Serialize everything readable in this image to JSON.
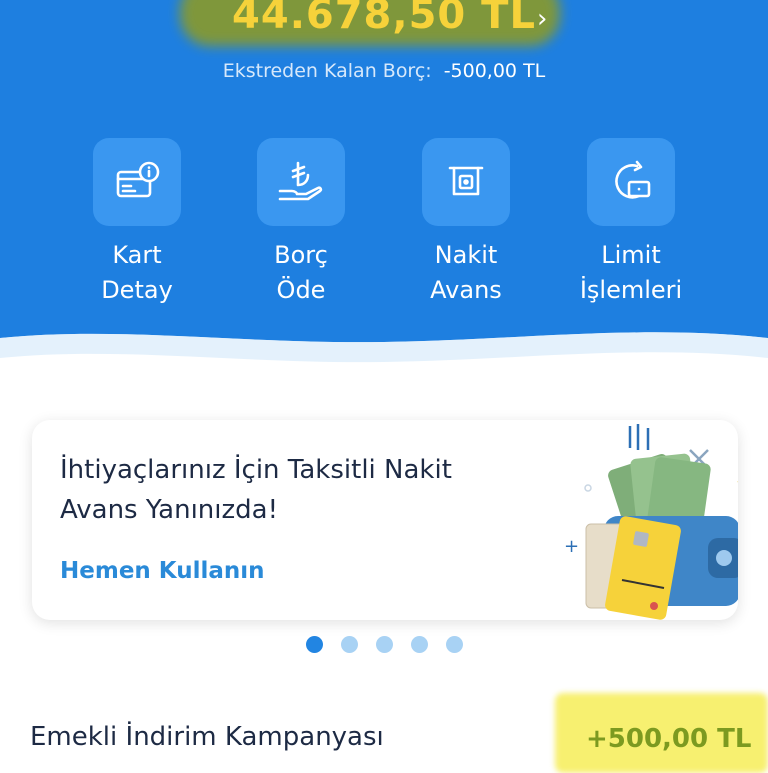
{
  "account": {
    "balance": "44.678,50 TL",
    "statement_label": "Ekstreden Kalan Borç:",
    "statement_value": "-500,00 TL"
  },
  "actions": [
    {
      "label": "Kart\nDetay",
      "icon": "card-info-icon"
    },
    {
      "label": "Borç\nÖde",
      "icon": "lira-hand-icon"
    },
    {
      "label": "Nakit\nAvans",
      "icon": "atm-cash-icon"
    },
    {
      "label": "Limit\nİşlemleri",
      "icon": "limit-refresh-icon"
    }
  ],
  "promo": {
    "title": "İhtiyaçlarınız İçin Taksitli Nakit Avans Yanınızda!",
    "link": "Hemen Kullanın",
    "illustration": "wallet-cash-card-illustration"
  },
  "carousel": {
    "total": 5,
    "active": 1
  },
  "campaign": {
    "name": "Emekli İndirim Kampanyası",
    "amount": "+500,00 TL"
  },
  "colors": {
    "header_blue": "#1e7fe0",
    "tile_blue": "#3a97f0",
    "balance_yellow": "#f6d23a",
    "link_blue": "#2a8ad8",
    "amount_green": "#7c9a20"
  }
}
